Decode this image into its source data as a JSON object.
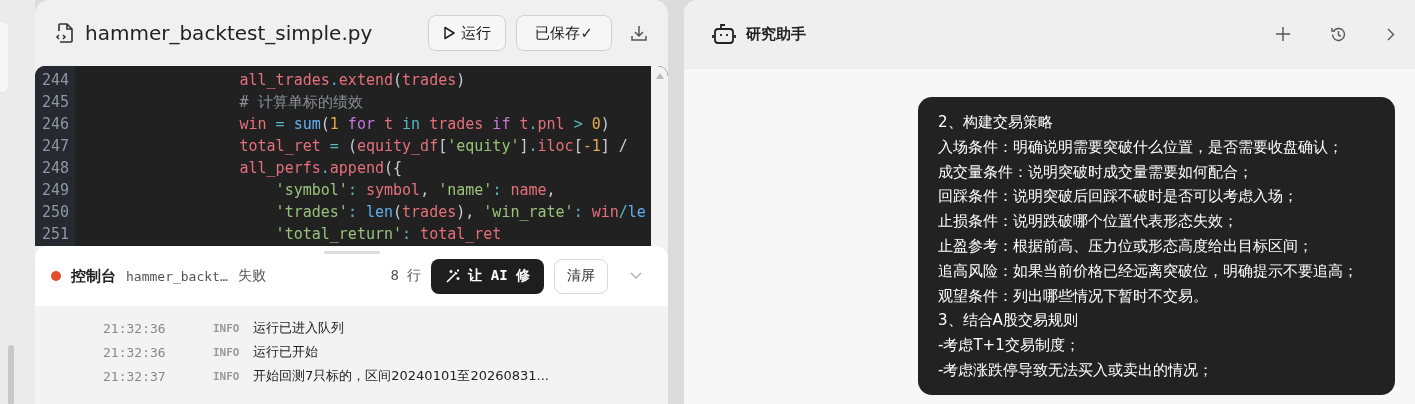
{
  "editor": {
    "file_name": "hammer_backtest_simple.py",
    "run_button": "运行",
    "save_button": "已保存✓",
    "code_lines": [
      {
        "number": "244",
        "tokens": [
          {
            "text": "                all_trades",
            "kind": "var"
          },
          {
            "text": ".",
            "kind": "op"
          },
          {
            "text": "extend",
            "kind": "var"
          },
          {
            "text": "(",
            "kind": "punc"
          },
          {
            "text": "trades",
            "kind": "var"
          },
          {
            "text": ")",
            "kind": "punc"
          }
        ]
      },
      {
        "number": "245",
        "tokens": [
          {
            "text": "                # 计算单标的绩效",
            "kind": "comment"
          }
        ]
      },
      {
        "number": "246",
        "tokens": [
          {
            "text": "                win",
            "kind": "var"
          },
          {
            "text": " = ",
            "kind": "op"
          },
          {
            "text": "sum",
            "kind": "func"
          },
          {
            "text": "(",
            "kind": "punc"
          },
          {
            "text": "1",
            "kind": "num"
          },
          {
            "text": " for ",
            "kind": "kw"
          },
          {
            "text": "t",
            "kind": "var"
          },
          {
            "text": " in ",
            "kind": "op"
          },
          {
            "text": "trades",
            "kind": "var"
          },
          {
            "text": " if ",
            "kind": "kw"
          },
          {
            "text": "t",
            "kind": "var"
          },
          {
            "text": ".",
            "kind": "op"
          },
          {
            "text": "pnl",
            "kind": "var"
          },
          {
            "text": " > ",
            "kind": "op"
          },
          {
            "text": "0",
            "kind": "num"
          },
          {
            "text": ")",
            "kind": "punc"
          }
        ]
      },
      {
        "number": "247",
        "tokens": [
          {
            "text": "                total_ret",
            "kind": "var"
          },
          {
            "text": " = ",
            "kind": "op"
          },
          {
            "text": "(",
            "kind": "punc"
          },
          {
            "text": "equity_df",
            "kind": "var"
          },
          {
            "text": "[",
            "kind": "punc"
          },
          {
            "text": "'equity'",
            "kind": "str"
          },
          {
            "text": "]",
            "kind": "punc"
          },
          {
            "text": ".",
            "kind": "op"
          },
          {
            "text": "iloc",
            "kind": "var"
          },
          {
            "text": "[",
            "kind": "punc"
          },
          {
            "text": "-1",
            "kind": "num"
          },
          {
            "text": "] / ",
            "kind": "punc"
          }
        ]
      },
      {
        "number": "248",
        "tokens": [
          {
            "text": "                all_perfs",
            "kind": "var"
          },
          {
            "text": ".",
            "kind": "op"
          },
          {
            "text": "append",
            "kind": "var"
          },
          {
            "text": "({",
            "kind": "punc"
          }
        ]
      },
      {
        "number": "249",
        "tokens": [
          {
            "text": "                    'symbol'",
            "kind": "str"
          },
          {
            "text": ": ",
            "kind": "op"
          },
          {
            "text": "symbol",
            "kind": "var"
          },
          {
            "text": ", ",
            "kind": "punc"
          },
          {
            "text": "'name'",
            "kind": "str"
          },
          {
            "text": ": ",
            "kind": "op"
          },
          {
            "text": "name",
            "kind": "var"
          },
          {
            "text": ",",
            "kind": "punc"
          }
        ]
      },
      {
        "number": "250",
        "tokens": [
          {
            "text": "                    'trades'",
            "kind": "str"
          },
          {
            "text": ": ",
            "kind": "op"
          },
          {
            "text": "len",
            "kind": "func"
          },
          {
            "text": "(",
            "kind": "punc"
          },
          {
            "text": "trades",
            "kind": "var"
          },
          {
            "text": "), ",
            "kind": "punc"
          },
          {
            "text": "'win_rate'",
            "kind": "str"
          },
          {
            "text": ": ",
            "kind": "op"
          },
          {
            "text": "win",
            "kind": "var"
          },
          {
            "text": "/",
            "kind": "op"
          },
          {
            "text": "le",
            "kind": "func"
          }
        ]
      },
      {
        "number": "251",
        "tokens": [
          {
            "text": "                    'total_return'",
            "kind": "str"
          },
          {
            "text": ": ",
            "kind": "op"
          },
          {
            "text": "total_ret",
            "kind": "var"
          }
        ]
      }
    ]
  },
  "console": {
    "title": "控制台",
    "file": "hammer_backt…",
    "status": "失败",
    "color": "#e0502a",
    "line_count": "8 行",
    "fix_button": "让 AI 修",
    "clear_button": "清屏",
    "logs": [
      {
        "time": "21:32:36",
        "level": "INFO",
        "message": "运行已进入队列"
      },
      {
        "time": "21:32:36",
        "level": "INFO",
        "message": "运行已开始"
      },
      {
        "time": "21:32:37",
        "level": "INFO",
        "message": "开始回测7只标的，区间20240101至20260831..."
      }
    ]
  },
  "assistant": {
    "title": "研究助手",
    "message_lines": [
      "2、构建交易策略",
      "入场条件：明确说明需要突破什么位置，是否需要收盘确认；",
      "成交量条件：说明突破时成交量需要如何配合；",
      "回踩条件：说明突破后回踩不破时是否可以考虑入场；",
      "止损条件：说明跌破哪个位置代表形态失效；",
      "止盈参考：根据前高、压力位或形态高度给出目标区间；",
      "追高风险：如果当前价格已经远离突破位，明确提示不要追高；",
      "观望条件：列出哪些情况下暂时不交易。",
      "3、结合A股交易规则",
      "-考虑T+1交易制度；",
      "-考虑涨跌停导致无法买入或卖出的情况；"
    ]
  }
}
